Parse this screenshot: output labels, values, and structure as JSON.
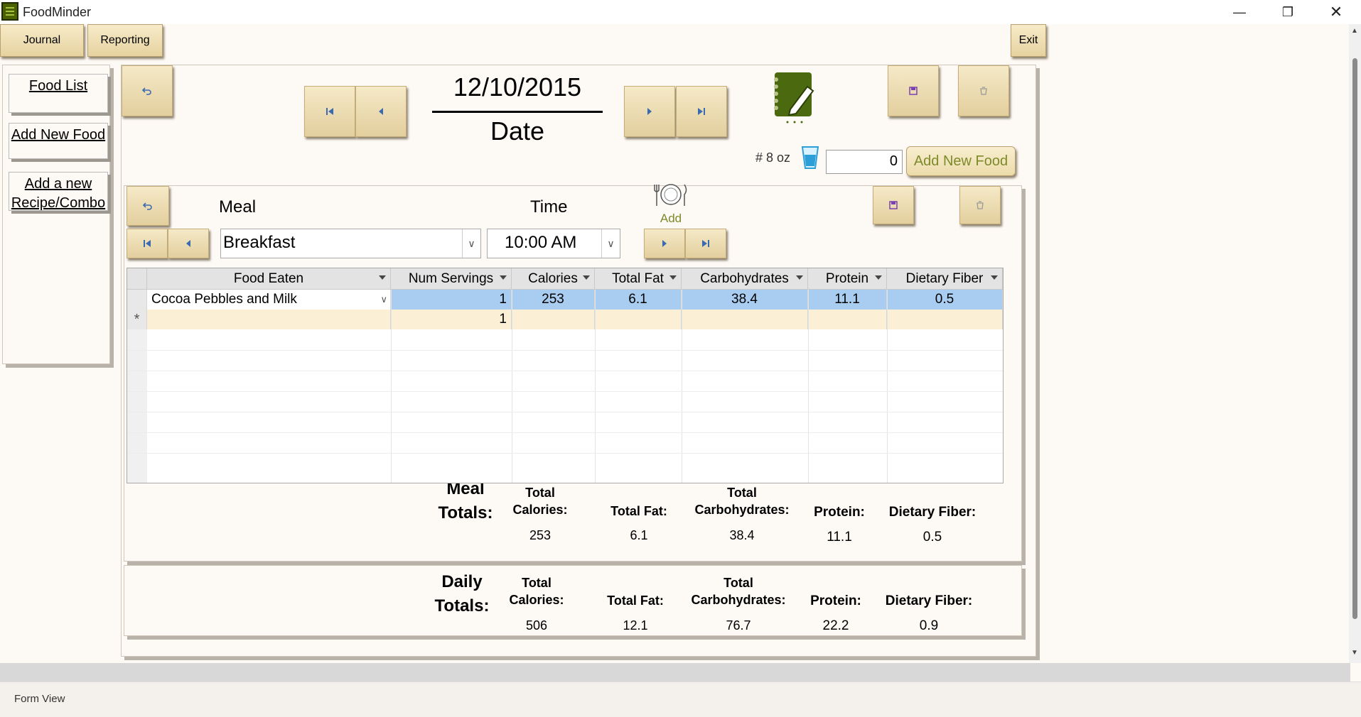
{
  "app": {
    "title": "FoodMinder"
  },
  "ribbon": {
    "journal": "Journal",
    "reporting": "Reporting",
    "exit": "Exit"
  },
  "nav": {
    "food_list": "Food List",
    "add_new_food": "Add New Food",
    "add_recipe": "Add a new Recipe/Combo"
  },
  "journal": {
    "date": "12/10/2015",
    "date_label": "Date",
    "water_label": "# 8 oz",
    "water_value": "0",
    "add_new_food": "Add New Food"
  },
  "meal": {
    "meal_label": "Meal",
    "time_label": "Time",
    "meal_value": "Breakfast",
    "time_value": "10:00 AM",
    "add_label": "Add"
  },
  "grid": {
    "columns": [
      "Food Eaten",
      "Num Servings",
      "Calories",
      "Total Fat",
      "Carbohydrates",
      "Protein",
      "Dietary Fiber"
    ],
    "row": {
      "food": "Cocoa Pebbles and Milk",
      "servings": "1",
      "calories": "253",
      "fat": "6.1",
      "carbs": "38.4",
      "protein": "11.1",
      "fiber": "0.5"
    },
    "new_row": {
      "marker": "*",
      "servings": "1"
    }
  },
  "meal_totals": {
    "label": "Meal Totals:",
    "calories_label": "Total Calories:",
    "calories": "253",
    "fat_label": "Total Fat:",
    "fat": "6.1",
    "carbs_label": "Total Carbohydrates:",
    "carbs": "38.4",
    "protein_label": "Protein:",
    "protein": "11.1",
    "fiber_label": "Dietary Fiber:",
    "fiber": "0.5"
  },
  "daily_totals": {
    "label": "Daily Totals:",
    "calories_label": "Total Calories:",
    "calories": "506",
    "fat_label": "Total Fat:",
    "fat": "12.1",
    "carbs_label": "Total Carbohydrates:",
    "carbs": "76.7",
    "protein_label": "Protein:",
    "protein": "22.2",
    "fiber_label": "Dietary Fiber:",
    "fiber": "0.9"
  },
  "status": {
    "view": "Form View"
  }
}
